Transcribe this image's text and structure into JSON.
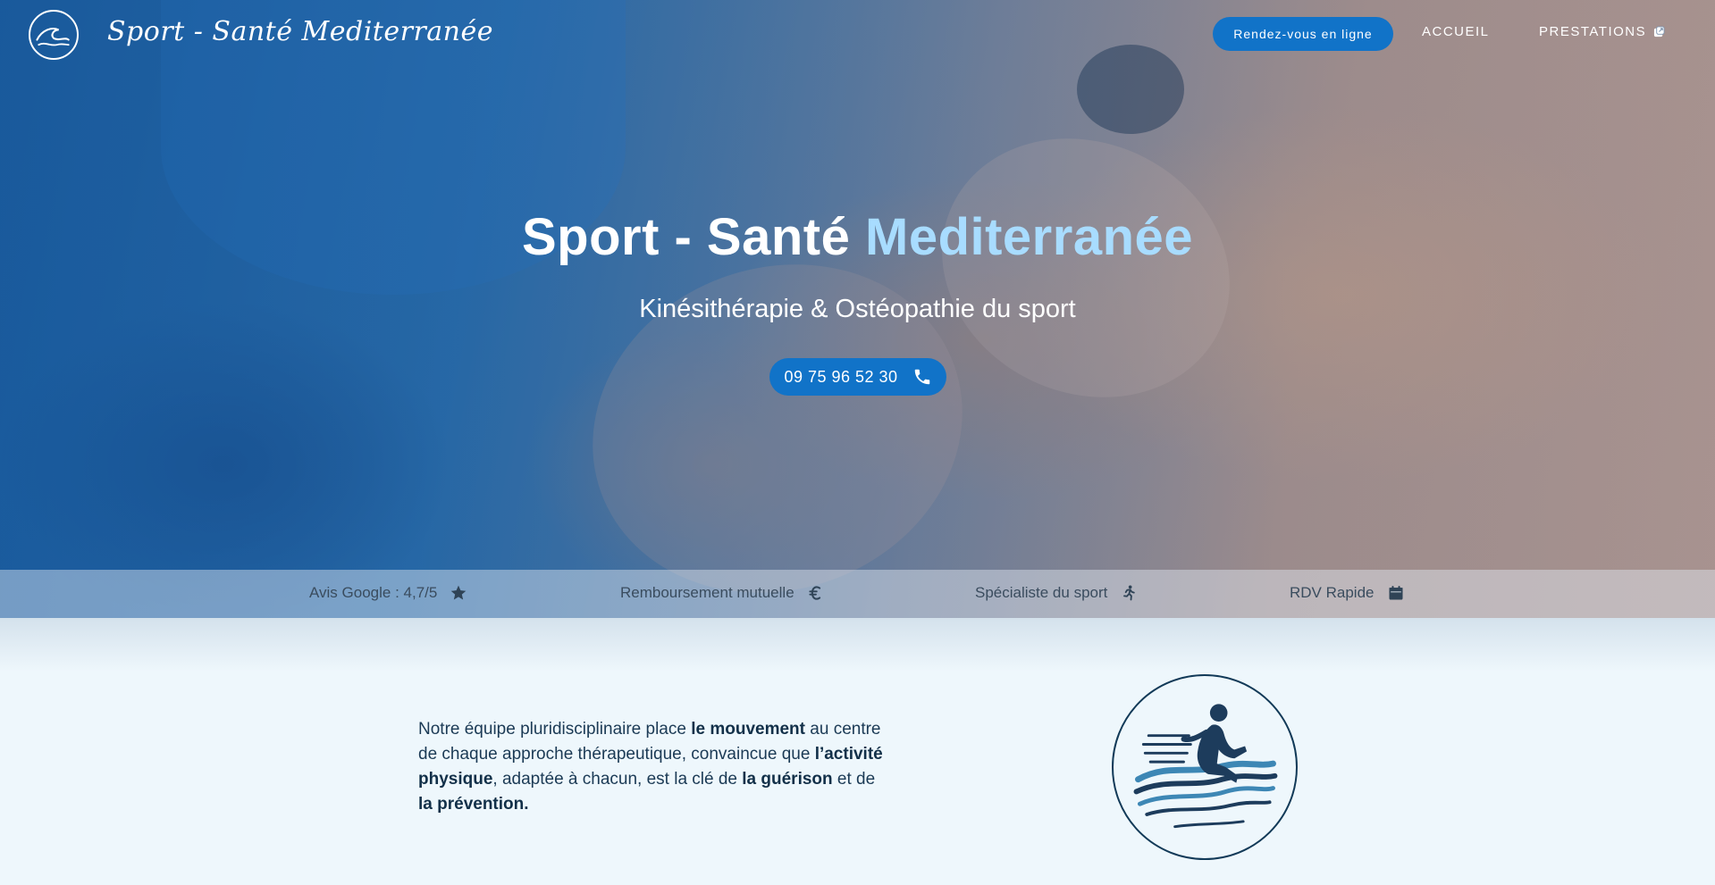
{
  "brand": {
    "name": "Sport - Santé Mediterranée"
  },
  "nav": {
    "rdv_button": "Rendez-vous en ligne",
    "links": [
      {
        "label": "ACCUEIL"
      },
      {
        "label": "PRESTATIONS"
      }
    ]
  },
  "hero": {
    "title_main": "Sport - Santé",
    "title_accent": "Mediterranée",
    "subtitle": "Kinésithérapie & Ostéopathie du sport",
    "phone": "09 75 96 52 30"
  },
  "features": [
    {
      "label": "Avis Google : 4,7/5",
      "icon": "star-icon"
    },
    {
      "label": "Remboursement mutuelle",
      "icon": "euro-icon"
    },
    {
      "label": "Spécialiste du sport",
      "icon": "running-icon"
    },
    {
      "label": "RDV Rapide",
      "icon": "calendar-icon"
    }
  ],
  "intro": {
    "p1": "Notre équipe pluridisciplinaire place ",
    "b1": "le mouvement",
    "p2": " au centre de chaque approche thérapeutique, convaincue que ",
    "b2": "l’activité physique",
    "p3": ", adaptée à chacun, est la clé de ",
    "b3": "la guérison",
    "p4": " et de ",
    "b4": "la prévention."
  },
  "colors": {
    "accent_blue": "#1173c8",
    "title_accent": "#a8dcff",
    "navy": "#123a58",
    "page_bg": "#eef7fc"
  }
}
